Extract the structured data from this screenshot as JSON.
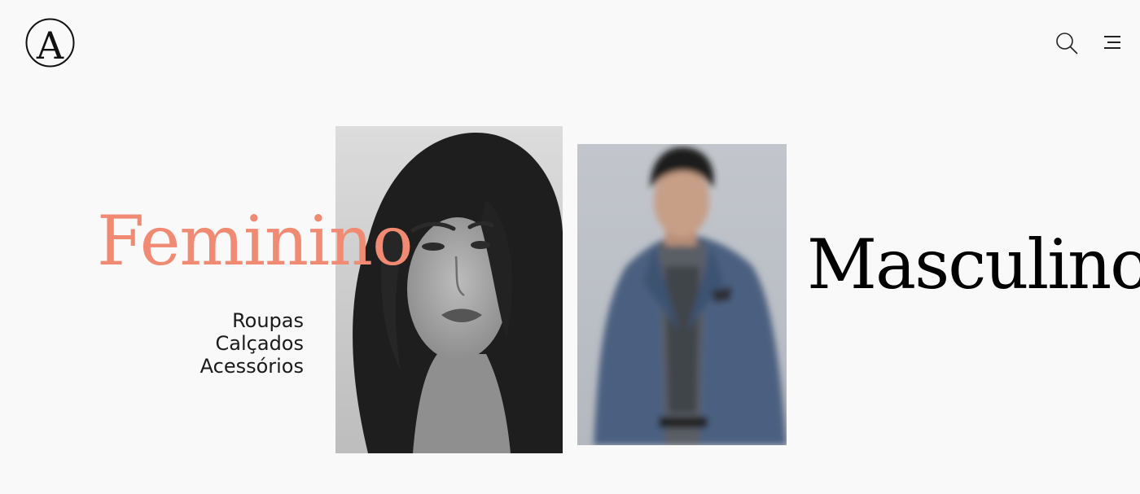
{
  "header": {
    "logo_letter": "A",
    "logo_icon": "monogram-logo",
    "search_icon": "search-icon",
    "menu_icon": "hamburger-menu-icon"
  },
  "feminino": {
    "title": "Feminino",
    "title_color": "#f08a72",
    "links": [
      "Roupas",
      "Calçados",
      "Acessórios"
    ],
    "image": "woman-portrait-photo"
  },
  "masculino": {
    "title": "Masculino",
    "title_color": "#000000",
    "image": "man-in-suit-photo"
  },
  "colors": {
    "background": "#f9f9f9",
    "accent": "#f08a72",
    "text": "#1a1a1a"
  }
}
